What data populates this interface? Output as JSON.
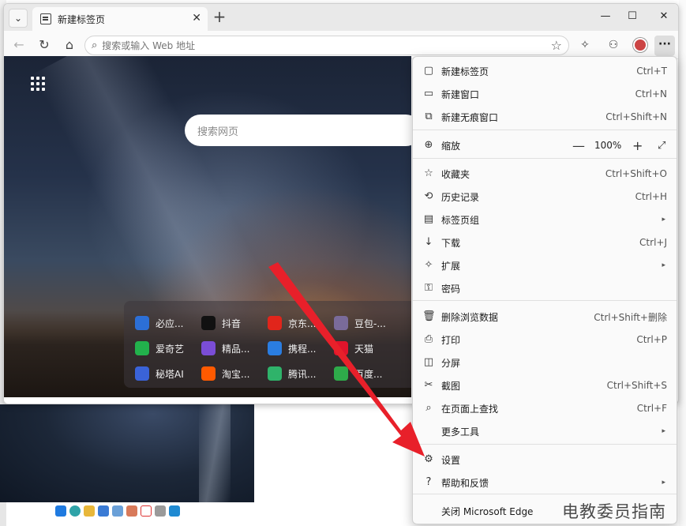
{
  "browser": {
    "tab_title": "新建标签页",
    "address_placeholder": "搜索或输入 Web 地址"
  },
  "newtab": {
    "search_placeholder": "搜索网页",
    "quick_links": [
      [
        {
          "label": "必应...",
          "color": "#2c6fd6",
          "icon": "search"
        },
        {
          "label": "抖音",
          "color": "#111111",
          "icon": "tiktok"
        },
        {
          "label": "京东...",
          "color": "#e1251b",
          "icon": "JD"
        },
        {
          "label": "豆包-...",
          "color": "#7a6b9a",
          "icon": "doubao"
        }
      ],
      [
        {
          "label": "爱奇艺",
          "color": "#22b14c",
          "icon": "iqiyi"
        },
        {
          "label": "精品...",
          "color": "#7a4dd6",
          "icon": "game"
        },
        {
          "label": "携程...",
          "color": "#2a7de1",
          "icon": "ctrip"
        },
        {
          "label": "天猫",
          "color": "#e0142b",
          "icon": "tmall"
        }
      ],
      [
        {
          "label": "秘塔AI",
          "color": "#3a63d8",
          "icon": "metaso"
        },
        {
          "label": "淘宝...",
          "color": "#ff5a00",
          "icon": "taobao"
        },
        {
          "label": "腾讯...",
          "color": "#2fb36a",
          "icon": "tencent"
        },
        {
          "label": "百度...",
          "color": "#2eaa4a",
          "icon": "wen"
        }
      ]
    ]
  },
  "menu": {
    "items": [
      {
        "label": "新建标签页",
        "shortcut": "Ctrl+T"
      },
      {
        "label": "新建窗口",
        "shortcut": "Ctrl+N"
      },
      {
        "label": "新建无痕窗口",
        "shortcut": "Ctrl+Shift+N"
      },
      {
        "label": "缩放",
        "zoom": "100%"
      },
      {
        "label": "收藏夹",
        "shortcut": "Ctrl+Shift+O"
      },
      {
        "label": "历史记录",
        "shortcut": "Ctrl+H"
      },
      {
        "label": "标签页组"
      },
      {
        "label": "下载",
        "shortcut": "Ctrl+J"
      },
      {
        "label": "扩展"
      },
      {
        "label": "密码"
      },
      {
        "label": "删除浏览数据",
        "shortcut": "Ctrl+Shift+删除"
      },
      {
        "label": "打印",
        "shortcut": "Ctrl+P"
      },
      {
        "label": "分屏"
      },
      {
        "label": "截图",
        "shortcut": "Ctrl+Shift+S"
      },
      {
        "label": "在页面上查找",
        "shortcut": "Ctrl+F"
      },
      {
        "label": "更多工具"
      },
      {
        "label": "设置"
      },
      {
        "label": "帮助和反馈"
      },
      {
        "label": "关闭 Microsoft Edge"
      }
    ]
  },
  "watermark": "电教委员指南",
  "colors": {
    "arrow": "#e8202a",
    "menu_bg": "#fafafa"
  }
}
